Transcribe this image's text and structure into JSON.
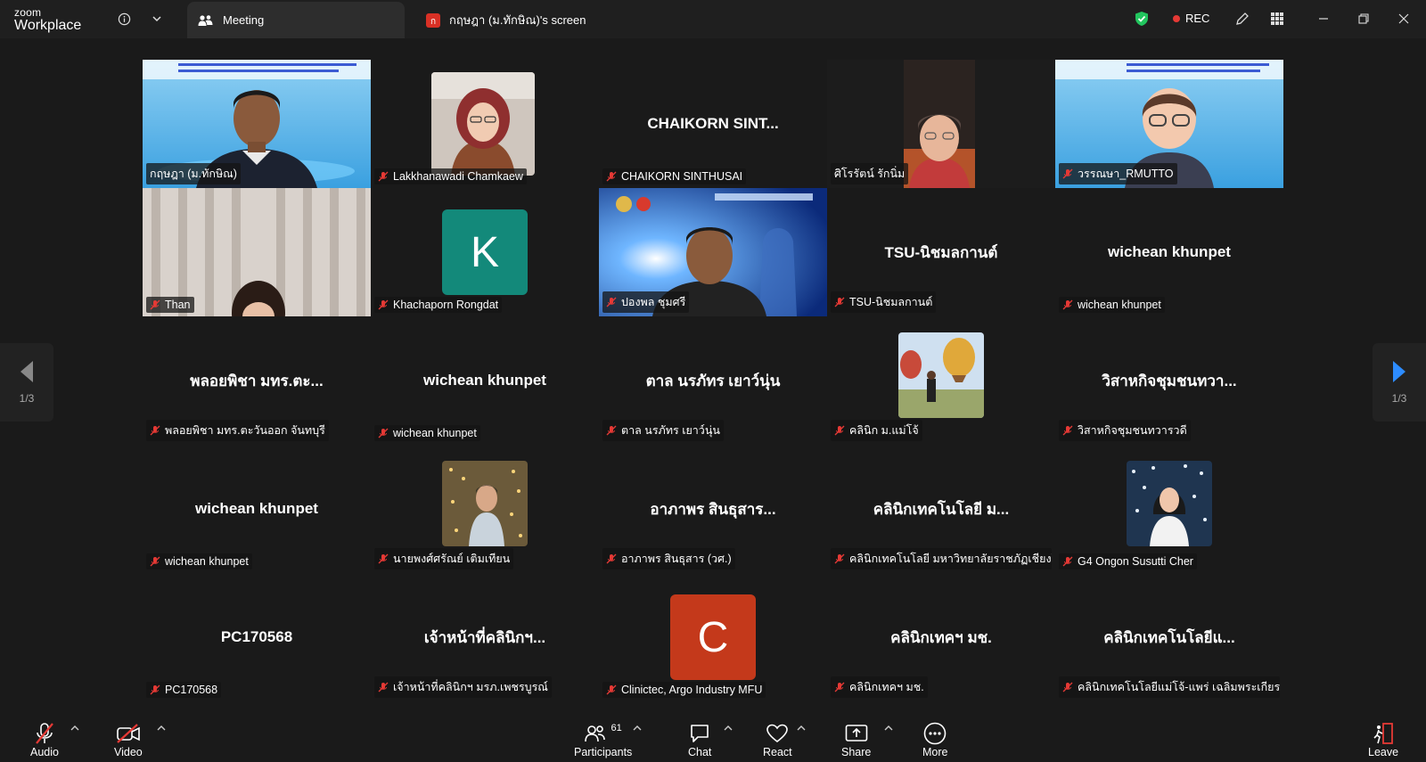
{
  "app": {
    "brand_top": "zoom",
    "brand_bottom": "Workplace"
  },
  "tabs": [
    {
      "label": "Meeting",
      "active": true
    },
    {
      "label": "กฤษฎา (ม.ทักษิณ)'s screen",
      "active": false
    }
  ],
  "status": {
    "rec_label": "REC"
  },
  "pager": {
    "left_label": "1/3",
    "right_label": "1/3"
  },
  "tiles": [
    {
      "name": "กฤษฎา (ม.ทักษิณ)",
      "big": "",
      "kind": "video",
      "speaking": true,
      "muted": false
    },
    {
      "name": "Lakkhanawadi Chamkaew",
      "big": "",
      "kind": "photo",
      "muted": true
    },
    {
      "name": "CHAIKORN SINTHUSAI",
      "big": "CHAIKORN  SINT...",
      "kind": "text",
      "muted": true
    },
    {
      "name": "ศิโรรัตน์ รักนิ่ม",
      "big": "",
      "kind": "video",
      "muted": false
    },
    {
      "name": "วรรณษา_RMUTTO",
      "big": "",
      "kind": "video",
      "muted": true
    },
    {
      "name": "Than",
      "big": "",
      "kind": "video",
      "muted": true
    },
    {
      "name": "Khachaporn Rongdat",
      "big": "",
      "kind": "letter",
      "letter": "K",
      "muted": true
    },
    {
      "name": "ปองพล ชุมศรี",
      "big": "",
      "kind": "video",
      "muted": true
    },
    {
      "name": "TSU-นิชมลกานต์",
      "big": "TSU-นิชมลกานต์",
      "kind": "text",
      "muted": true
    },
    {
      "name": "wichean khunpet",
      "big": "wichean khunpet",
      "kind": "text",
      "muted": true
    },
    {
      "name": "พลอยพิชา มทร.ตะวันออก จันทบุรี",
      "big": "พลอยพิชา มทร.ตะ...",
      "kind": "text",
      "muted": true
    },
    {
      "name": "wichean khunpet",
      "big": "wichean khunpet",
      "kind": "text",
      "muted": true
    },
    {
      "name": "ตาล นรภัทร เยาว์นุ่น",
      "big": "ตาล นรภัทร เยาว์นุ่น",
      "kind": "text",
      "muted": true
    },
    {
      "name": "คลินิก ม.แม่โจ้",
      "big": "",
      "kind": "photo",
      "muted": true
    },
    {
      "name": "วิสาหกิจชุมชนทวารวดี",
      "big": "วิสาหกิจชุมชนทวา...",
      "kind": "text",
      "muted": true
    },
    {
      "name": "wichean khunpet",
      "big": "wichean khunpet",
      "kind": "text",
      "muted": true
    },
    {
      "name": "นายพงศ์ศรัณย์ เติมเทียน",
      "big": "",
      "kind": "photo",
      "muted": true
    },
    {
      "name": "อาภาพร สินธุสาร (วศ.)",
      "big": "อาภาพร สินธุสาร...",
      "kind": "text",
      "muted": true
    },
    {
      "name": "คลินิกเทคโนโลยี มหาวิทยาลัยราชภัฏเชียงใหม่",
      "big": "คลินิกเทคโนโลยี ม...",
      "kind": "text",
      "muted": true
    },
    {
      "name": "G4 Ongon  Susutti Cher",
      "big": "",
      "kind": "photo",
      "muted": true
    },
    {
      "name": "PC170568",
      "big": "PC170568",
      "kind": "text",
      "muted": true
    },
    {
      "name": "เจ้าหน้าที่คลินิกฯ มรภ.เพชรบูรณ์",
      "big": "เจ้าหน้าที่คลินิกฯ...",
      "kind": "text",
      "muted": true
    },
    {
      "name": "Clinictec, Argo Industry MFU",
      "big": "",
      "kind": "letter",
      "letter": "C",
      "muted": true
    },
    {
      "name": "คลินิกเทคฯ มช.",
      "big": "คลินิกเทคฯ มช.",
      "kind": "text",
      "muted": true
    },
    {
      "name": "คลินิกเทคโนโลยีแม่โจ้-แพร่ เฉลิมพระเกียรติ",
      "big": "คลินิกเทคโนโลยีแ...",
      "kind": "text",
      "muted": true
    }
  ],
  "toolbar": {
    "audio": "Audio",
    "video": "Video",
    "participants": "Participants",
    "participants_count": "61",
    "chat": "Chat",
    "react": "React",
    "share": "Share",
    "more": "More",
    "leave": "Leave"
  },
  "colors": {
    "speaking": "#2ecc71",
    "k_avatar": "#13897a",
    "c_avatar": "#c4391b",
    "rec": "#e53935",
    "shield": "#22c55e",
    "accent": "#2d8cff"
  }
}
